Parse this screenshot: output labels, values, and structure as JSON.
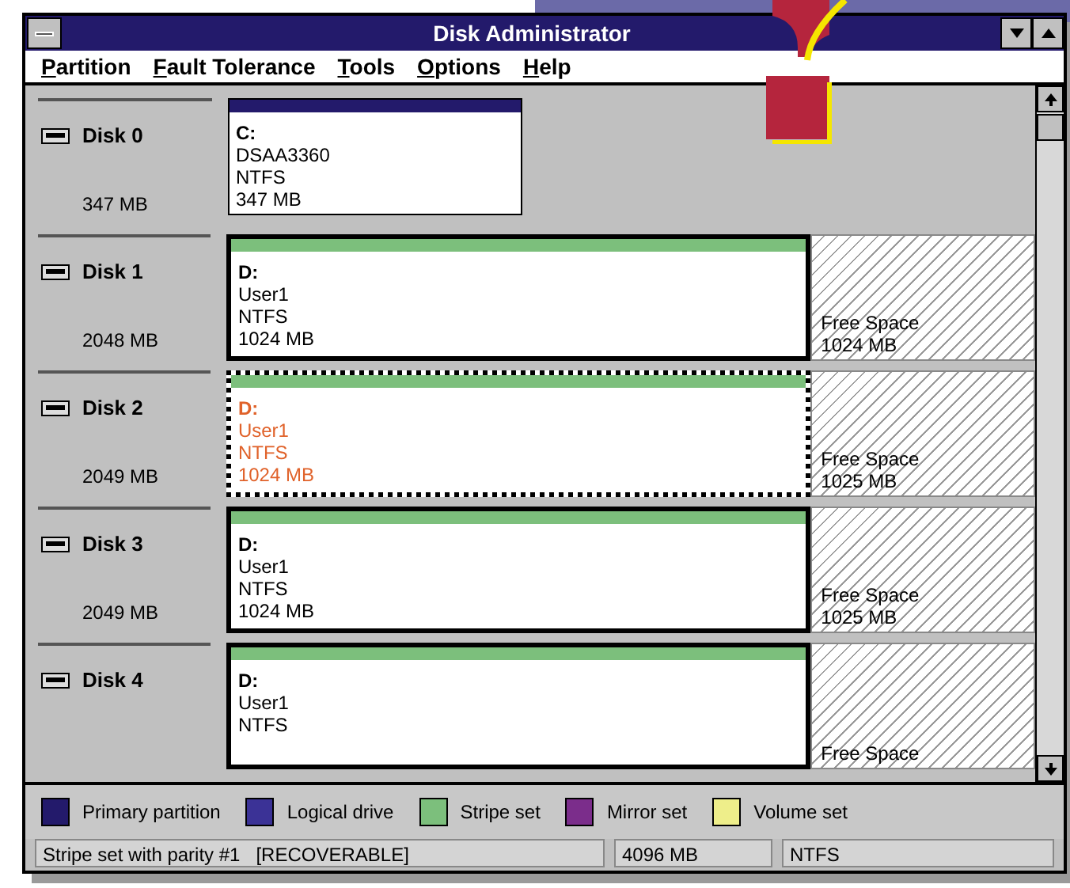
{
  "window": {
    "title": "Disk Administrator"
  },
  "menu": [
    "Partition",
    "Fault Tolerance",
    "Tools",
    "Options",
    "Help"
  ],
  "disks": [
    {
      "name": "Disk 0",
      "size": "347 MB",
      "partitions": [
        {
          "kind": "primary",
          "selected": false,
          "orphan": false,
          "lines": [
            "C:",
            "DSAA3360",
            "NTFS",
            "347 MB"
          ]
        }
      ]
    },
    {
      "name": "Disk 1",
      "size": "2048 MB",
      "partitions": [
        {
          "kind": "stripe",
          "selected": true,
          "orphan": false,
          "lines": [
            "D:",
            "User1",
            "NTFS",
            "1024 MB"
          ]
        },
        {
          "kind": "free",
          "selected": false,
          "orphan": false,
          "lines": [
            "Free Space",
            "1024 MB"
          ]
        }
      ]
    },
    {
      "name": "Disk 2",
      "size": "2049 MB",
      "partitions": [
        {
          "kind": "stripe",
          "selected": true,
          "orphan": true,
          "lines": [
            "D:",
            "User1",
            "NTFS",
            "1024 MB"
          ]
        },
        {
          "kind": "free",
          "selected": false,
          "orphan": false,
          "lines": [
            "Free Space",
            "1025 MB"
          ]
        }
      ]
    },
    {
      "name": "Disk 3",
      "size": "2049 MB",
      "partitions": [
        {
          "kind": "stripe",
          "selected": true,
          "orphan": false,
          "lines": [
            "D:",
            "User1",
            "NTFS",
            "1024 MB"
          ]
        },
        {
          "kind": "free",
          "selected": false,
          "orphan": false,
          "lines": [
            "Free Space",
            "1025 MB"
          ]
        }
      ]
    },
    {
      "name": "Disk 4",
      "partitions": [
        {
          "kind": "stripe",
          "selected": true,
          "orphan": false,
          "lines": [
            "D:",
            "User1",
            "NTFS"
          ]
        },
        {
          "kind": "free",
          "selected": false,
          "orphan": false,
          "lines": [
            "Free Space"
          ]
        }
      ]
    }
  ],
  "legend": [
    {
      "label": "Primary partition",
      "color": "#231a6b"
    },
    {
      "label": "Logical drive",
      "color": "#3b3296"
    },
    {
      "label": "Stripe set",
      "color": "#7cbf7c"
    },
    {
      "label": "Mirror set",
      "color": "#7b2d8b"
    },
    {
      "label": "Volume set",
      "color": "#eeee8a"
    }
  ],
  "status_bar": [
    "Stripe set with parity #1   [RECOVERABLE]",
    "4096 MB",
    "NTFS"
  ]
}
